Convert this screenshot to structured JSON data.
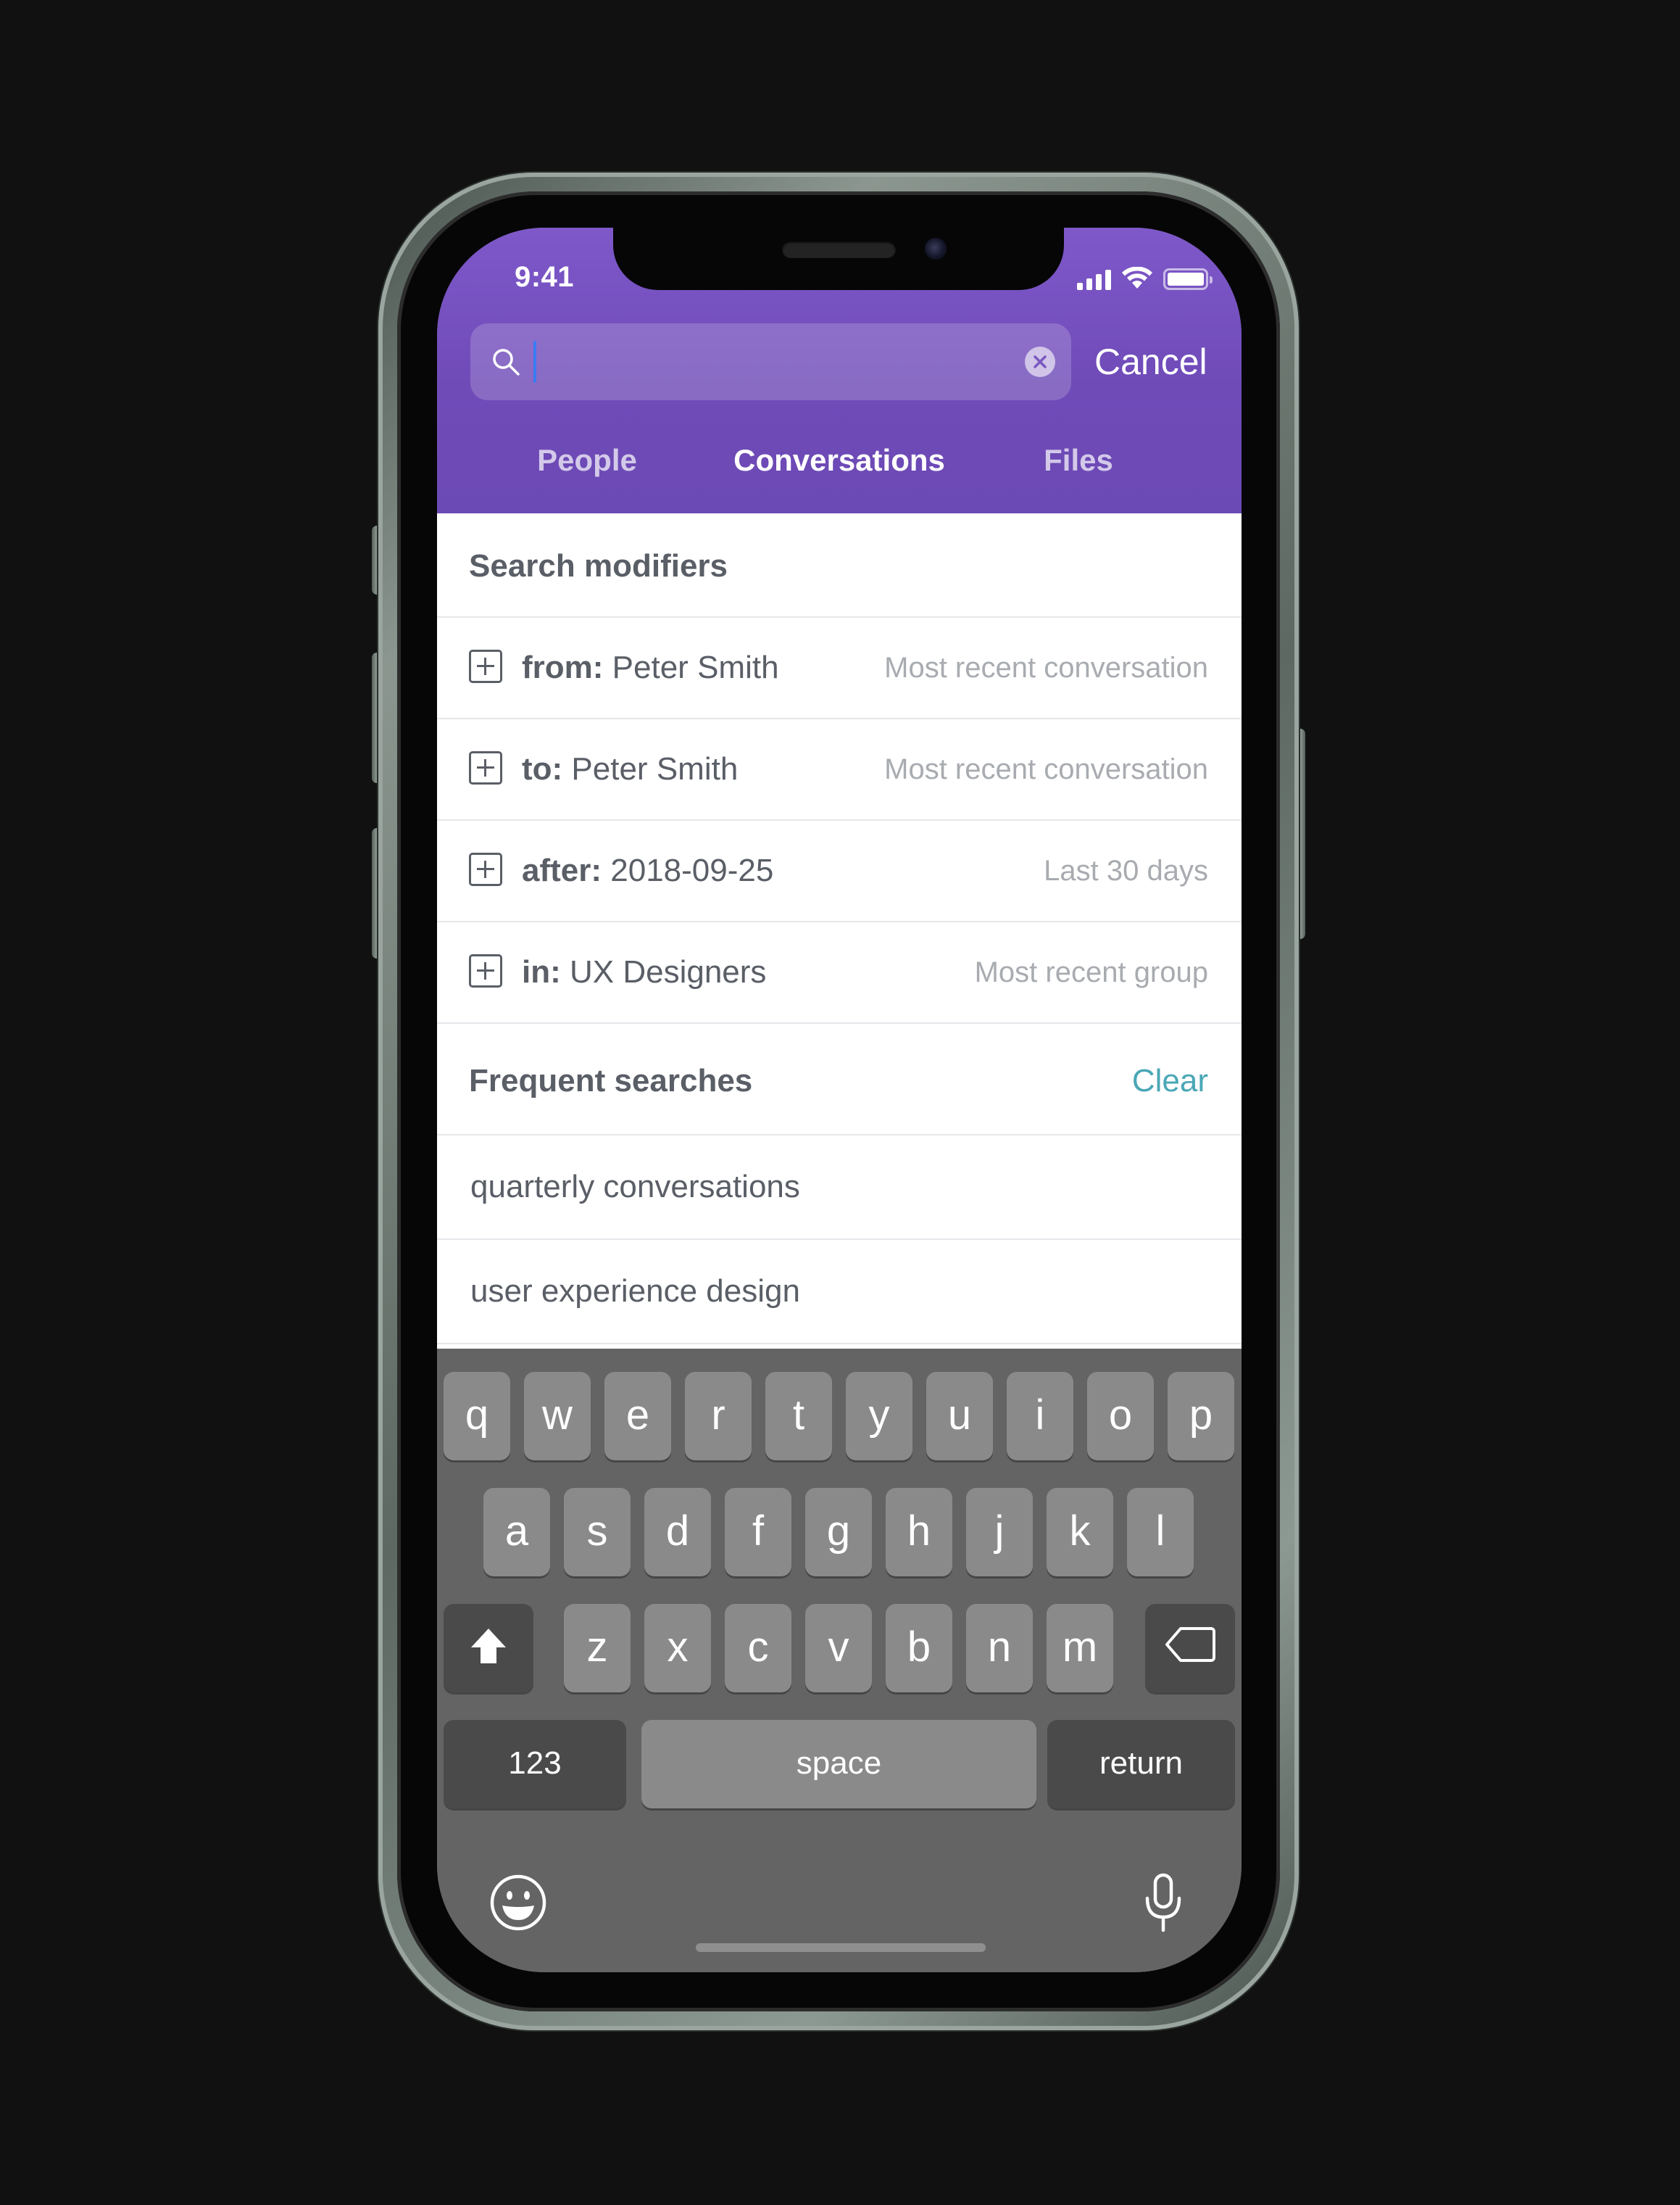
{
  "status_bar": {
    "time": "9:41"
  },
  "search": {
    "value": "",
    "placeholder": "",
    "cancel_label": "Cancel"
  },
  "tabs": [
    {
      "label": "People",
      "active": false
    },
    {
      "label": "Conversations",
      "active": true
    },
    {
      "label": "Files",
      "active": false
    }
  ],
  "search_modifiers": {
    "title": "Search modifiers",
    "items": [
      {
        "key": "from:",
        "value": "Peter Smith",
        "hint": "Most recent conversation"
      },
      {
        "key": "to:",
        "value": "Peter Smith",
        "hint": "Most recent conversation"
      },
      {
        "key": "after:",
        "value": "2018-09-25",
        "hint": "Last 30 days"
      },
      {
        "key": "in:",
        "value": "UX Designers",
        "hint": "Most recent group"
      }
    ]
  },
  "frequent_searches": {
    "title": "Frequent searches",
    "clear_label": "Clear",
    "items": [
      "quarterly conversations",
      "user experience design"
    ]
  },
  "keyboard": {
    "row1": [
      "q",
      "w",
      "e",
      "r",
      "t",
      "y",
      "u",
      "i",
      "o",
      "p"
    ],
    "row2": [
      "a",
      "s",
      "d",
      "f",
      "g",
      "h",
      "j",
      "k",
      "l"
    ],
    "row3": [
      "z",
      "x",
      "c",
      "v",
      "b",
      "n",
      "m"
    ],
    "numbers_label": "123",
    "space_label": "space",
    "return_label": "return"
  },
  "colors": {
    "header_purple": "#7352bd",
    "accent_teal": "#4aa7b6",
    "caret_blue": "#3a7bf5",
    "keyboard_bg": "#646464",
    "page_bg": "#111111"
  }
}
